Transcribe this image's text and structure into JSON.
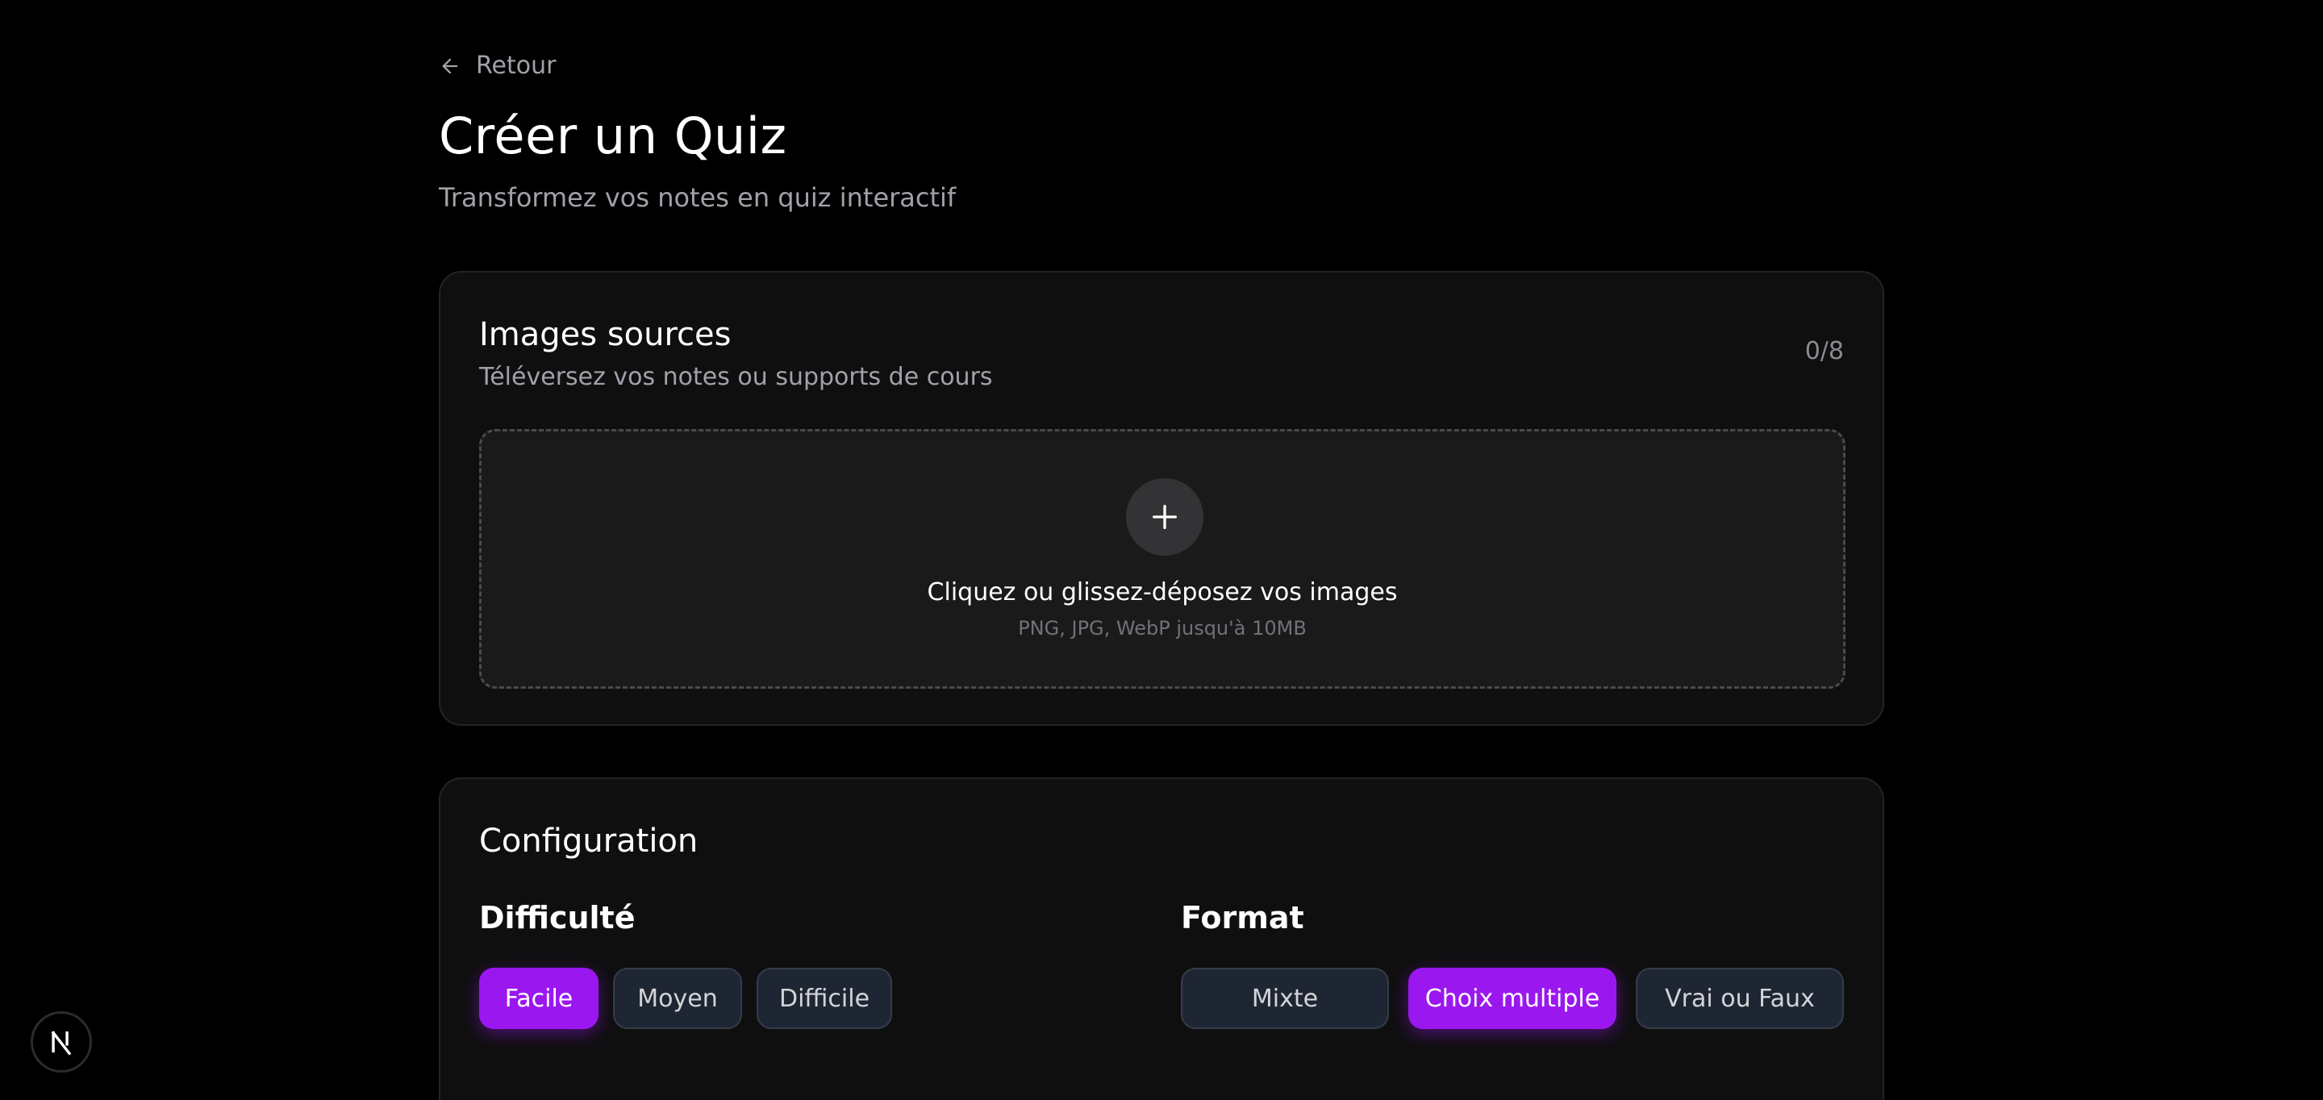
{
  "header": {
    "back_label": "Retour",
    "title": "Créer un Quiz",
    "subtitle": "Transformez vos notes en quiz interactif"
  },
  "images_card": {
    "title": "Images sources",
    "description": "Téléversez vos notes ou supports de cours",
    "counter": "0/8",
    "dropzone": {
      "icon": "plus-icon",
      "text": "Cliquez ou glissez-déposez vos images",
      "hint": "PNG, JPG, WebP jusqu'à 10MB"
    }
  },
  "config_card": {
    "title": "Configuration",
    "difficulty": {
      "label": "Difficulté",
      "options": [
        "Facile",
        "Moyen",
        "Difficile"
      ],
      "selected": "Facile"
    },
    "format": {
      "label": "Format",
      "options": [
        "Mixte",
        "Choix multiple",
        "Vrai ou Faux"
      ],
      "selected": "Choix multiple"
    }
  },
  "colors": {
    "background": "#000000",
    "card": "#0f0f0f",
    "accent": "#9b17f0",
    "pill_inactive": "#1f2633",
    "muted_text": "#a1a1aa"
  },
  "badge": {
    "icon": "nextjs-logo-icon"
  }
}
